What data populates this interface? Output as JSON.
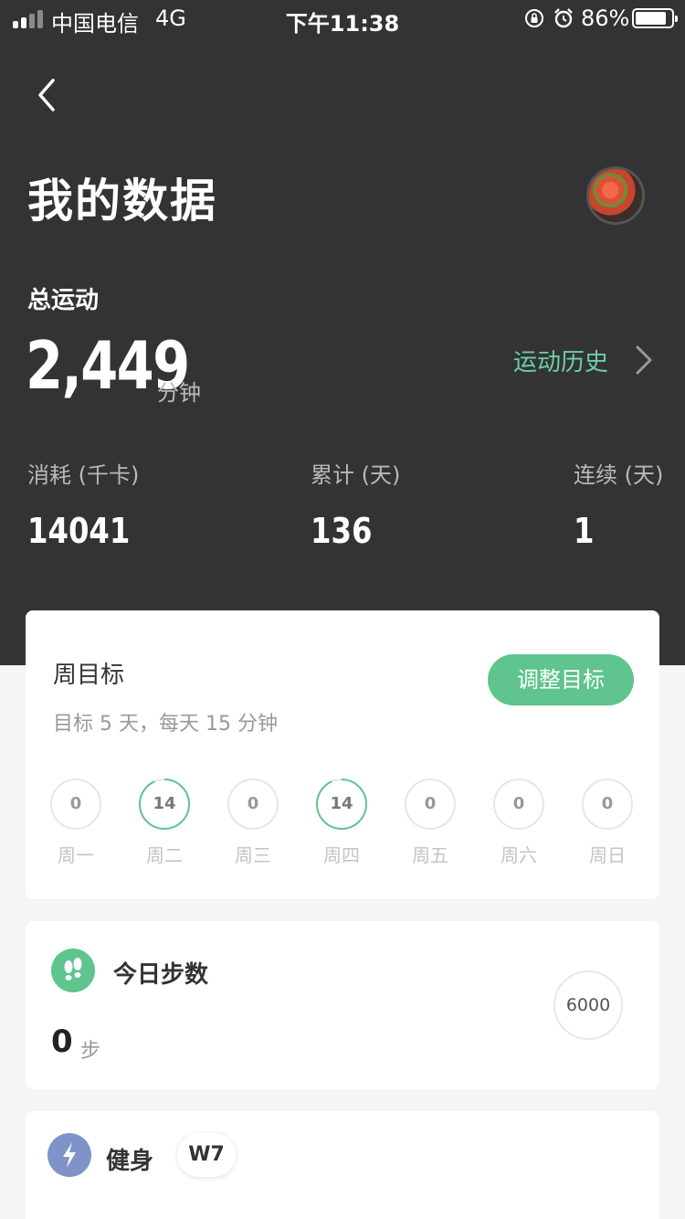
{
  "status_bar": {
    "carrier": "中国电信",
    "network": "4G",
    "time": "下午11:38",
    "battery": "86%",
    "battery_level": 0.86
  },
  "header": {
    "title": "我的数据"
  },
  "summary": {
    "total_label": "总运动",
    "total_value": "2,449",
    "total_unit": "分钟",
    "history_link": "运动历史",
    "stats": [
      {
        "label": "消耗 (千卡)",
        "value": "14041"
      },
      {
        "label": "累计 (天)",
        "value": "136"
      },
      {
        "label": "连续 (天)",
        "value": "1"
      }
    ]
  },
  "weekly_goal": {
    "title": "周目标",
    "subtitle": "目标 5 天，每天 15 分钟",
    "adjust_button": "调整目标",
    "target_minutes": 15,
    "days": [
      {
        "label": "周一",
        "value": "0"
      },
      {
        "label": "周二",
        "value": "14"
      },
      {
        "label": "周三",
        "value": "0"
      },
      {
        "label": "周四",
        "value": "14"
      },
      {
        "label": "周五",
        "value": "0"
      },
      {
        "label": "周六",
        "value": "0"
      },
      {
        "label": "周日",
        "value": "0"
      }
    ]
  },
  "steps": {
    "title": "今日步数",
    "value": "0",
    "unit": "步",
    "goal": "6000",
    "icon": "footprints-icon"
  },
  "fitness": {
    "title": "健身",
    "badge": "W7",
    "icon": "lightning-icon"
  },
  "colors": {
    "accent": "#5fc48d",
    "history_link": "#6ccfa3",
    "dark_bg": "#333335",
    "fitness_icon": "#7f93c9"
  }
}
